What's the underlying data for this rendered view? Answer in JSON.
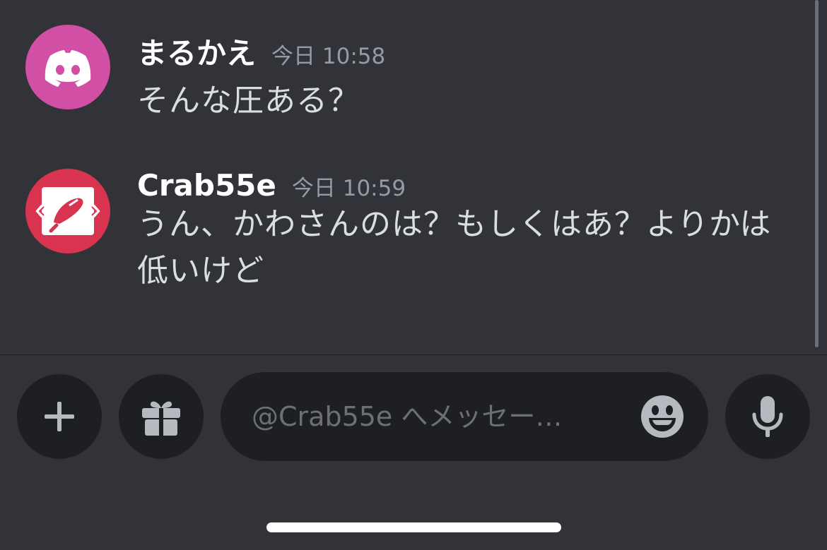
{
  "messages": [
    {
      "username": "まるかえ",
      "timestamp": "今日 10:58",
      "text": "そんな圧ある？",
      "avatar_icon": "discord-logo-icon",
      "avatar_color": "#d24fa6"
    },
    {
      "username": "Crab55e",
      "timestamp": "今日 10:59",
      "text": "うん、かわさんのは？もしくはあ？よりかは低いけど",
      "avatar_icon": "crab-claw-icon",
      "avatar_color": "#d8334f"
    }
  ],
  "composer": {
    "placeholder": "@Crab55e へメッセー…",
    "add_icon": "plus-icon",
    "gift_icon": "gift-icon",
    "emoji_icon": "emoji-smile-icon",
    "mic_icon": "microphone-icon"
  },
  "colors": {
    "background": "#313338",
    "input_background": "#1e1f22",
    "username": "#ffffff",
    "timestamp": "#949ba4",
    "message_text": "#dbdee1",
    "icon": "#b5bac1"
  }
}
